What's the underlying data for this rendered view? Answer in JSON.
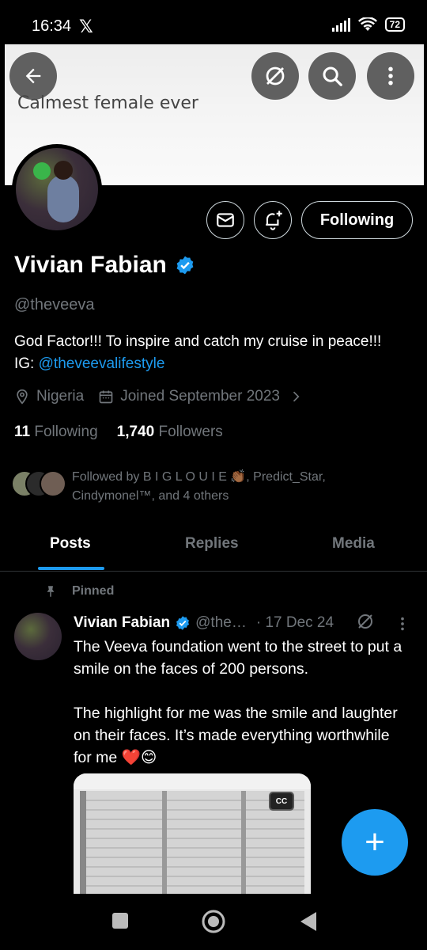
{
  "status": {
    "time": "16:34",
    "x_glyph": "𝕏",
    "battery": "72"
  },
  "banner": {
    "text": "Calmest female ever"
  },
  "profile": {
    "following_label": "Following",
    "name": "Vivian Fabian",
    "handle": "@theveeva",
    "bio": "God Factor!!! To inspire and catch my cruise in peace!!!",
    "bio_ig_prefix": "IG: ",
    "bio_ig_link": "@theveevalifestyle",
    "location": "Nigeria",
    "joined": "Joined September 2023",
    "following_count": "11",
    "following_text": "Following",
    "followers_count": "1,740",
    "followers_text": "Followers",
    "followed_by": "Followed by B I G L O U I E 👏🏾, Predict_Star, Cindymonel™, and 4 others"
  },
  "tabs": [
    "Posts",
    "Replies",
    "Media"
  ],
  "post": {
    "pinned_label": "Pinned",
    "name": "Vivian Fabian",
    "handle": "@the…",
    "date": "· 17 Dec 24",
    "body": "The Veeva foundation went to the street to put a smile on the faces of 200 persons.\n\nThe highlight for me was the smile and laughter on their faces. It’s made everything worthwhile for me ❤️😊",
    "cc_label": "CC"
  },
  "fab": {
    "glyph": "+"
  },
  "colors": {
    "accent": "#1d9bf0",
    "muted": "#71767b",
    "background": "#000000"
  },
  "icons": [
    "back-arrow-icon",
    "grok-icon",
    "search-icon",
    "more-icon",
    "message-icon",
    "bell-plus-icon",
    "verified-icon",
    "location-icon",
    "calendar-icon",
    "chevron-right-icon",
    "pin-icon",
    "more-vert-icon",
    "square-icon",
    "home-circle-icon",
    "back-triangle-icon"
  ]
}
